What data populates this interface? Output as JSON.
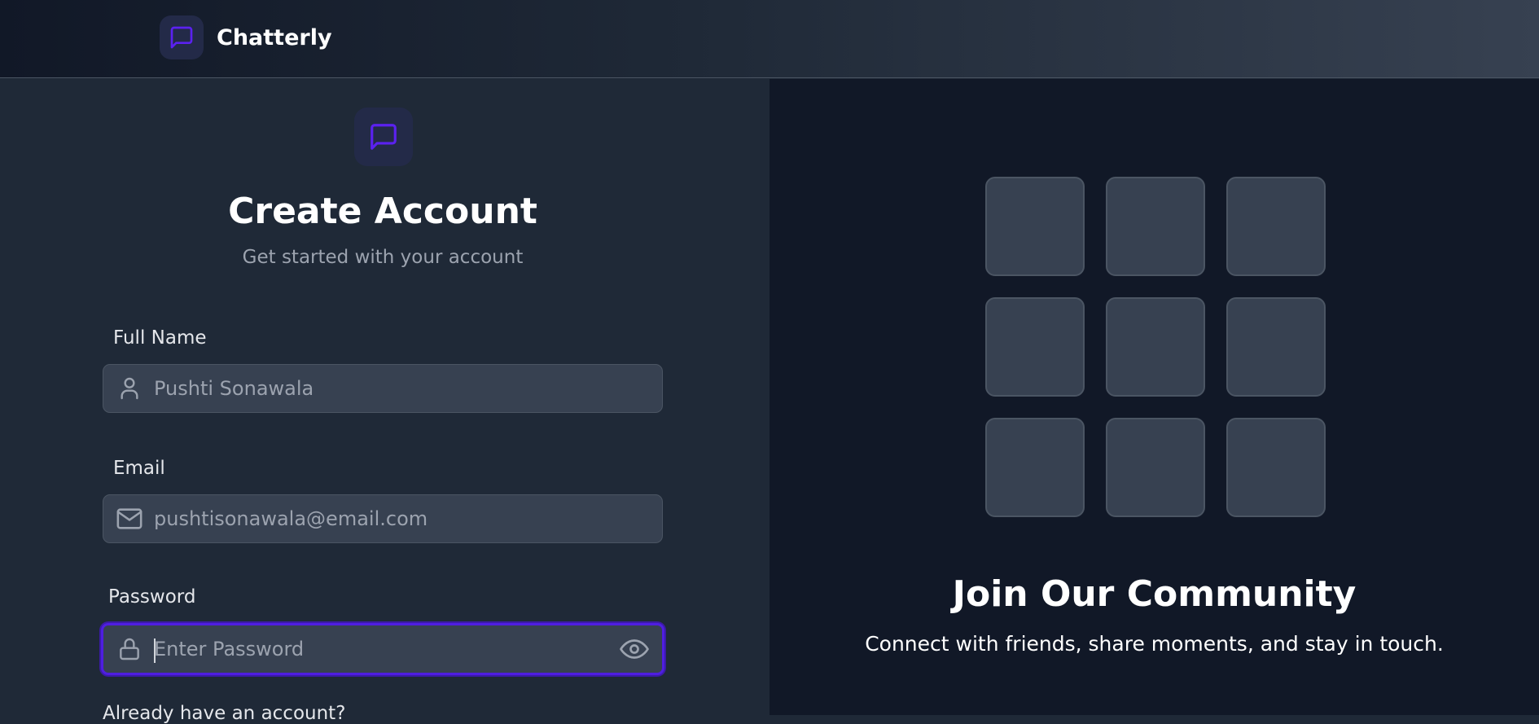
{
  "header": {
    "brand_name": "Chatterly",
    "logo_icon": "chat-bubble-icon"
  },
  "form": {
    "logo_icon": "chat-bubble-icon",
    "title": "Create Account",
    "subtitle": "Get started with your account",
    "fields": {
      "full_name": {
        "label": "Full Name",
        "value": "",
        "placeholder": "Pushti Sonawala",
        "icon": "user-icon"
      },
      "email": {
        "label": "Email",
        "value": "",
        "placeholder": "pushtisonawala@email.com",
        "icon": "mail-icon"
      },
      "password": {
        "label": "Password",
        "value": "",
        "placeholder": "Enter Password",
        "icon": "lock-icon",
        "toggle_icon": "eye-icon"
      }
    },
    "footer_text": "Already have an account?"
  },
  "community": {
    "title": "Join Our Community",
    "text": "Connect with friends, share moments, and stay in touch.",
    "tile_count": 9
  },
  "colors": {
    "accent": "#5b21f0",
    "panel_left": "#1f2937",
    "panel_right": "#111827",
    "input_bg": "#374151"
  }
}
